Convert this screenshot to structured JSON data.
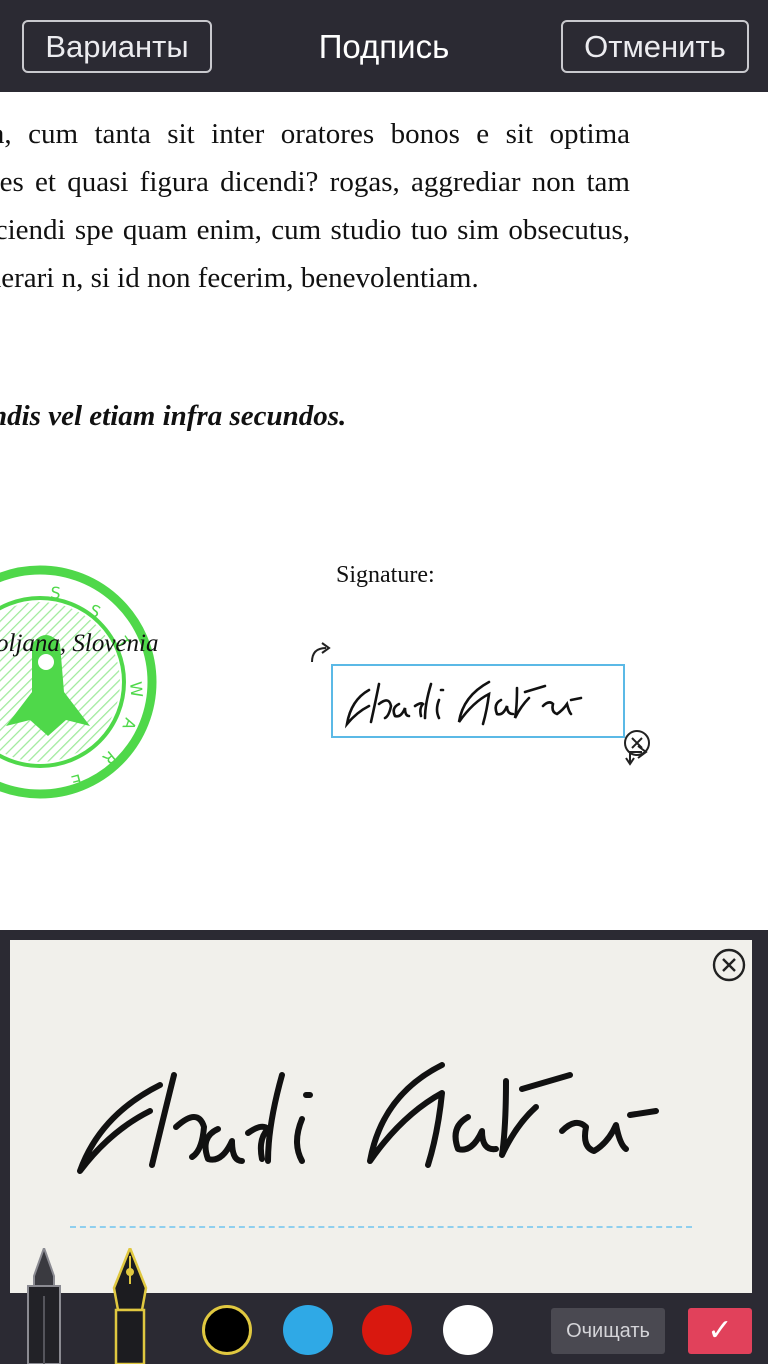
{
  "header": {
    "left_button": "Варианты",
    "title": "Подпись",
    "right_button": "Отменить"
  },
  "document": {
    "paragraph": "quam, cum tanta sit inter oratores bonos e sit optima species et quasi figura dicendi? rogas, aggrediar non tam perficiendi spe quam enim, cum studio tuo sim obsecutus, desiderari n, si id non fecerim, benevolentiam.",
    "bold_line": "cundis vel etiam infra secundos.",
    "stamp_text": "oljana, Slovenia",
    "signature_caption": "Signature:"
  },
  "colors": {
    "toolbar_bg": "#2b2a33",
    "stamp_green": "#4fd84a",
    "selection_border": "#5bb9e6",
    "swatches": [
      "#000000",
      "#2fa9e6",
      "#d9180f",
      "#ffffff"
    ],
    "confirm": "#e1415b"
  },
  "toolbar": {
    "tools": [
      "marker-pen-icon",
      "fountain-pen-icon"
    ],
    "clear_label": "Очищать",
    "confirm_icon": "✓"
  }
}
